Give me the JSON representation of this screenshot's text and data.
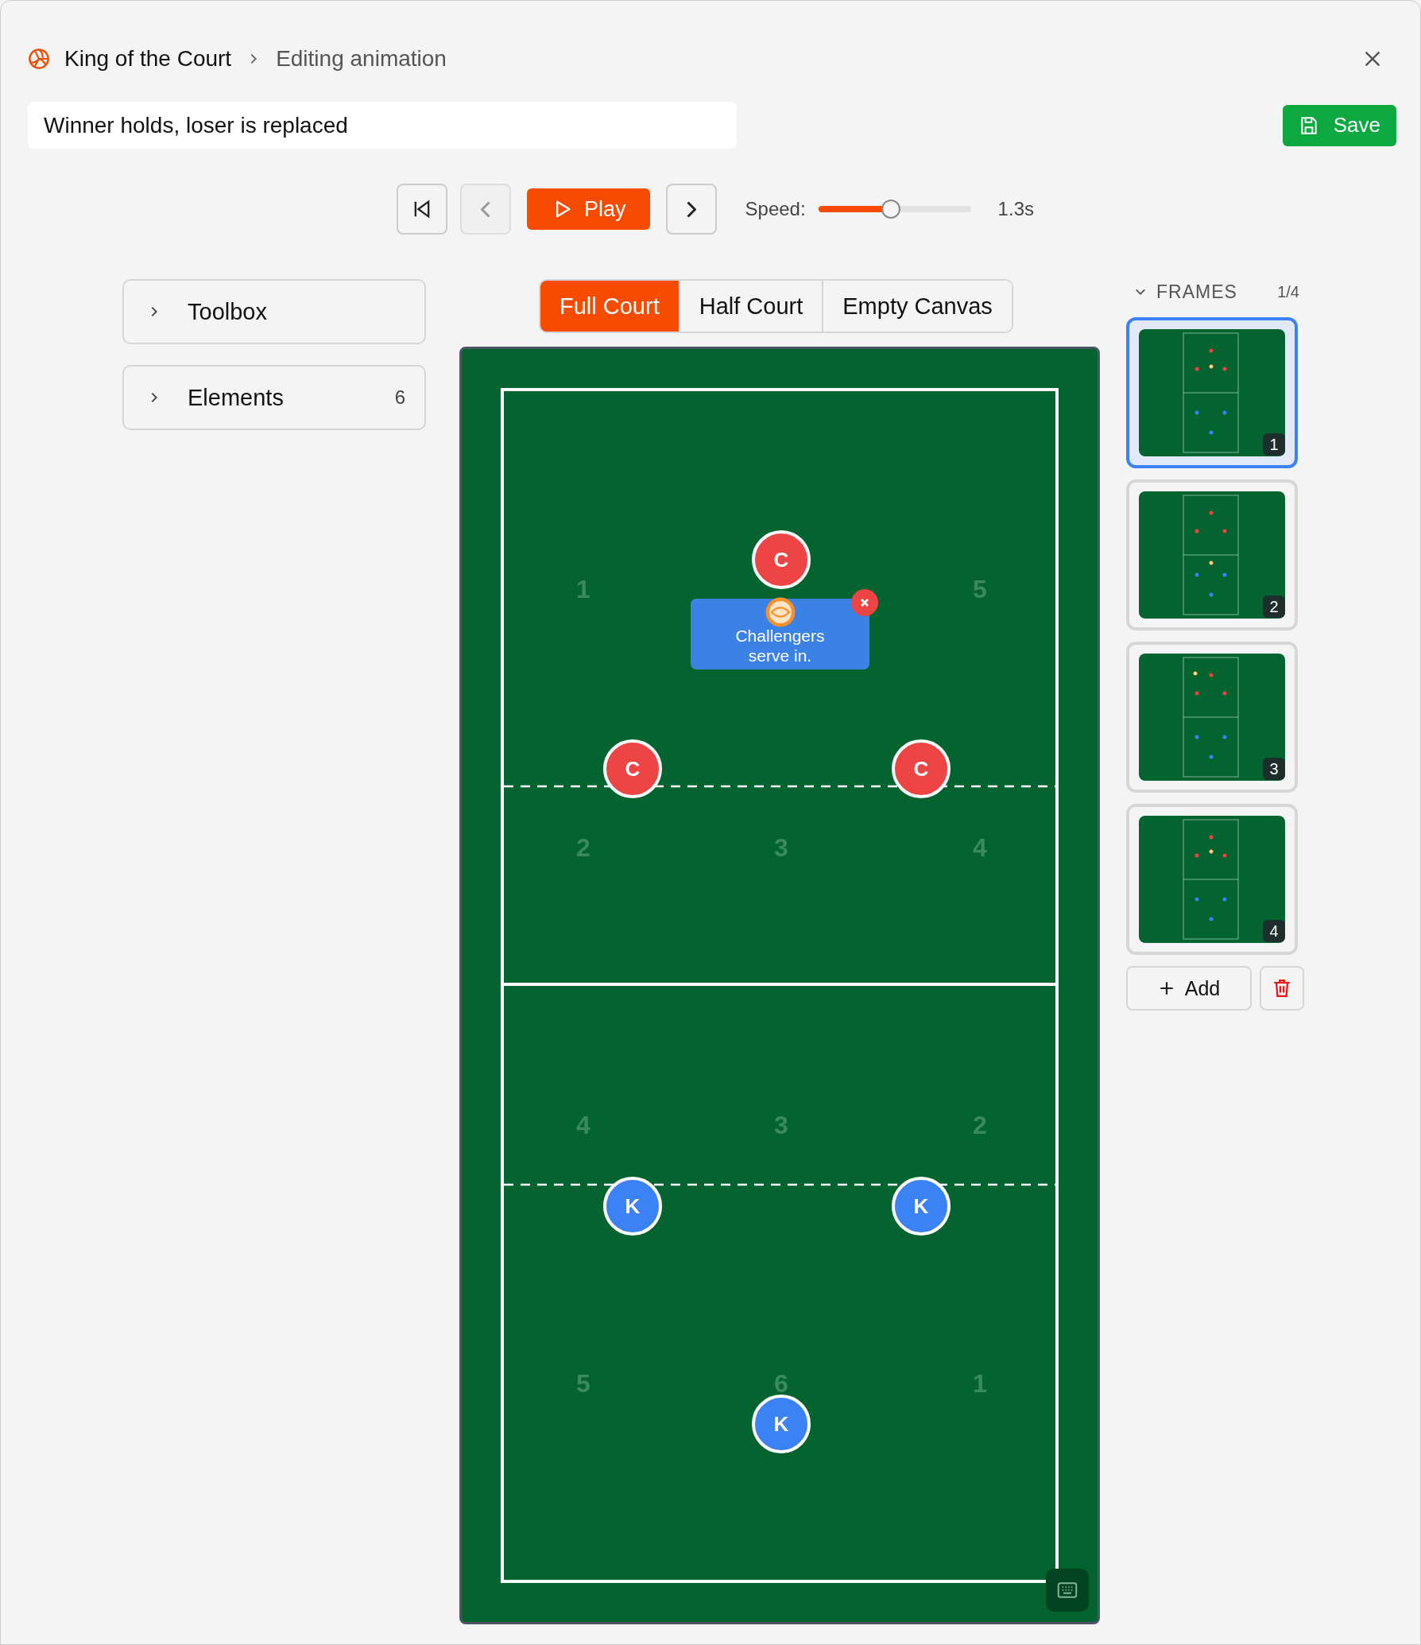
{
  "breadcrumb": {
    "title": "King of the Court",
    "current": "Editing animation"
  },
  "name_field": {
    "value": "Winner holds, loser is replaced"
  },
  "save_button": "Save",
  "playback": {
    "play_label": "Play",
    "prev_disabled": true,
    "speed_label": "Speed:",
    "level": 0.47,
    "reading": "1.3s"
  },
  "panels": [
    {
      "label": "Toolbox",
      "expanded": false
    },
    {
      "label": "Elements",
      "expanded": false,
      "count": "6"
    }
  ],
  "court_tabs": [
    {
      "label": "Full Court",
      "selected": true
    },
    {
      "label": "Half Court",
      "selected": false
    },
    {
      "label": "Empty Canvas",
      "selected": false
    }
  ],
  "court": {
    "zones": [
      "1",
      "5",
      "2",
      "3",
      "4",
      "4",
      "3",
      "2",
      "5",
      "6",
      "1"
    ],
    "players": [
      {
        "label": "C",
        "kind": "challenger"
      },
      {
        "label": "C",
        "kind": "challenger"
      },
      {
        "label": "C",
        "kind": "challenger"
      },
      {
        "label": "K",
        "kind": "king"
      },
      {
        "label": "K",
        "kind": "king"
      },
      {
        "label": "K",
        "kind": "king"
      }
    ],
    "note": "Challengers serve in."
  },
  "frames": {
    "title": "FRAMES",
    "expanded": true,
    "counter": "1/4",
    "items": [
      {
        "number": "1",
        "selected": true
      },
      {
        "number": "2",
        "selected": false
      },
      {
        "number": "3",
        "selected": false
      },
      {
        "number": "4",
        "selected": false
      }
    ],
    "add_label": "Add"
  }
}
